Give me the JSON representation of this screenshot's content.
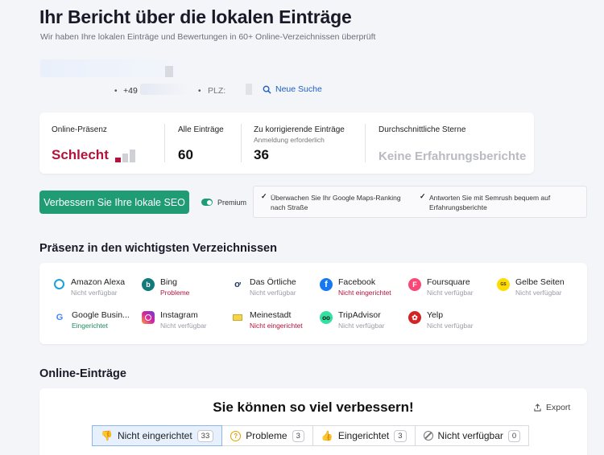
{
  "header": {
    "title": "Ihr Bericht über die lokalen Einträge",
    "subtitle": "Wir haben Ihre lokalen Einträge und Bewertungen in 60+ Online-Verzeichnissen überprüft"
  },
  "info": {
    "phone": "+49",
    "plz_label": "PLZ:",
    "new_search": "Neue Suche"
  },
  "stats": {
    "presence_label": "Online-Präsenz",
    "presence_value": "Schlecht",
    "all_label": "Alle Einträge",
    "all_value": "60",
    "fix_label": "Zu korrigierende Einträge",
    "fix_sub": "Anmeldung erforderlich",
    "fix_value": "36",
    "stars_label": "Durchschnittliche Sterne",
    "stars_value": "Keine Erfahrungsberichte"
  },
  "cta": {
    "button": "Verbessern Sie Ihre lokale SEO",
    "premium": "Premium",
    "feature1": "Überwachen Sie Ihr Google Maps-Ranking nach Straße",
    "feature2": "Antworten Sie mit Semrush bequem auf Erfahrungsberichte"
  },
  "directories": {
    "heading": "Präsenz in den wichtigsten Verzeichnissen",
    "items": [
      {
        "name": "Amazon Alexa",
        "status": "Nicht verfügbar",
        "icon": "alexa-icon",
        "color": "#19a3d6"
      },
      {
        "name": "Bing",
        "status": "Probleme",
        "icon": "bing-icon",
        "color": "#127a7a"
      },
      {
        "name": "Das Örtliche",
        "status": "Nicht verfügbar",
        "icon": "das-oertliche-icon",
        "color": "#1f3b66"
      },
      {
        "name": "Facebook",
        "status": "Nicht eingerichtet",
        "icon": "facebook-icon",
        "color": "#1877f2"
      },
      {
        "name": "Foursquare",
        "status": "Nicht verfügbar",
        "icon": "foursquare-icon",
        "color": "#f94877"
      },
      {
        "name": "Gelbe Seiten",
        "status": "Nicht verfügbar",
        "icon": "gelbe-seiten-icon",
        "color": "#ffdc00"
      },
      {
        "name": "Google Busin...",
        "status": "Eingerichtet",
        "icon": "google-icon",
        "color": "#4285f4"
      },
      {
        "name": "Instagram",
        "status": "Nicht verfügbar",
        "icon": "instagram-icon",
        "color": "#d6249f"
      },
      {
        "name": "Meinestadt",
        "status": "Nicht eingerichtet",
        "icon": "meinestadt-icon",
        "color": "#f5d547"
      },
      {
        "name": "TripAdvisor",
        "status": "Nicht verfügbar",
        "icon": "tripadvisor-icon",
        "color": "#34e0a1"
      },
      {
        "name": "Yelp",
        "status": "Nicht verfügbar",
        "icon": "yelp-icon",
        "color": "#d32323"
      }
    ]
  },
  "online": {
    "heading": "Online-Einträge",
    "headline": "Sie können so viel verbessern!",
    "export": "Export",
    "tabs": [
      {
        "label": "Nicht eingerichtet",
        "count": "33"
      },
      {
        "label": "Probleme",
        "count": "3"
      },
      {
        "label": "Eingerichtet",
        "count": "3"
      },
      {
        "label": "Nicht verfügbar",
        "count": "0"
      }
    ]
  },
  "colors": {
    "accent_green": "#1f9c74",
    "bad_red": "#b3123a",
    "link_blue": "#1a5fc8"
  }
}
